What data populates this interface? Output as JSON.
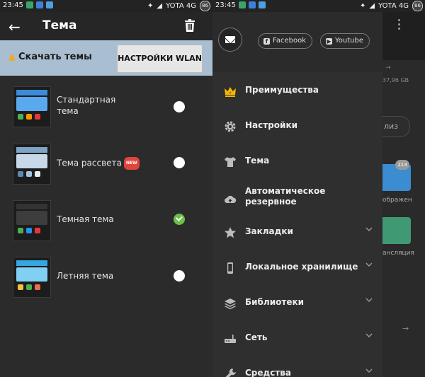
{
  "status": {
    "time_left": "23:45",
    "time_right": "23:45",
    "carrier": "YOTA 4G",
    "battery": "86"
  },
  "left": {
    "title": "Тема",
    "download_label": "Скачать темы",
    "wlan_button": "НАСТРОЙКИ WLAN",
    "themes": [
      {
        "name_line1": "Стандартная",
        "name_line2": "тема",
        "selected": false
      },
      {
        "name_line1": "Тема рассвета",
        "badge": "NEW",
        "selected": false
      },
      {
        "name_line1": "Темная тема",
        "selected": true
      },
      {
        "name_line1": "Летняя тема",
        "selected": false
      }
    ]
  },
  "right": {
    "social": {
      "facebook": "Facebook",
      "youtube": "Youtube"
    },
    "menu": [
      {
        "label": "Преимущества",
        "icon": "crown-icon"
      },
      {
        "label": "Настройки",
        "icon": "gear-icon"
      },
      {
        "label": "Тема",
        "icon": "shirt-icon"
      },
      {
        "label_line1": "Автоматическое",
        "label_line2": "резервное",
        "icon": "cloud-backup-icon"
      },
      {
        "label": "Закладки",
        "icon": "star-icon",
        "expandable": true
      },
      {
        "label": "Локальное хранилище",
        "icon": "phone-icon",
        "expandable": true
      },
      {
        "label": "Библиотеки",
        "icon": "layers-icon",
        "expandable": true
      },
      {
        "label": "Сеть",
        "icon": "router-icon",
        "expandable": true
      },
      {
        "label": "Средства",
        "icon": "wrench-icon",
        "expandable": true
      }
    ],
    "background": {
      "storage_text": "37,96 GB",
      "button_text": "лиз",
      "badge_count": "213",
      "label_images": "ображен",
      "label_cast": "ансляция"
    }
  },
  "colors": {
    "accent_green": "#6cc04a",
    "banner_bg": "#a9bed0",
    "new_badge": "#e0453c",
    "crown_gold": "#f2b705"
  }
}
